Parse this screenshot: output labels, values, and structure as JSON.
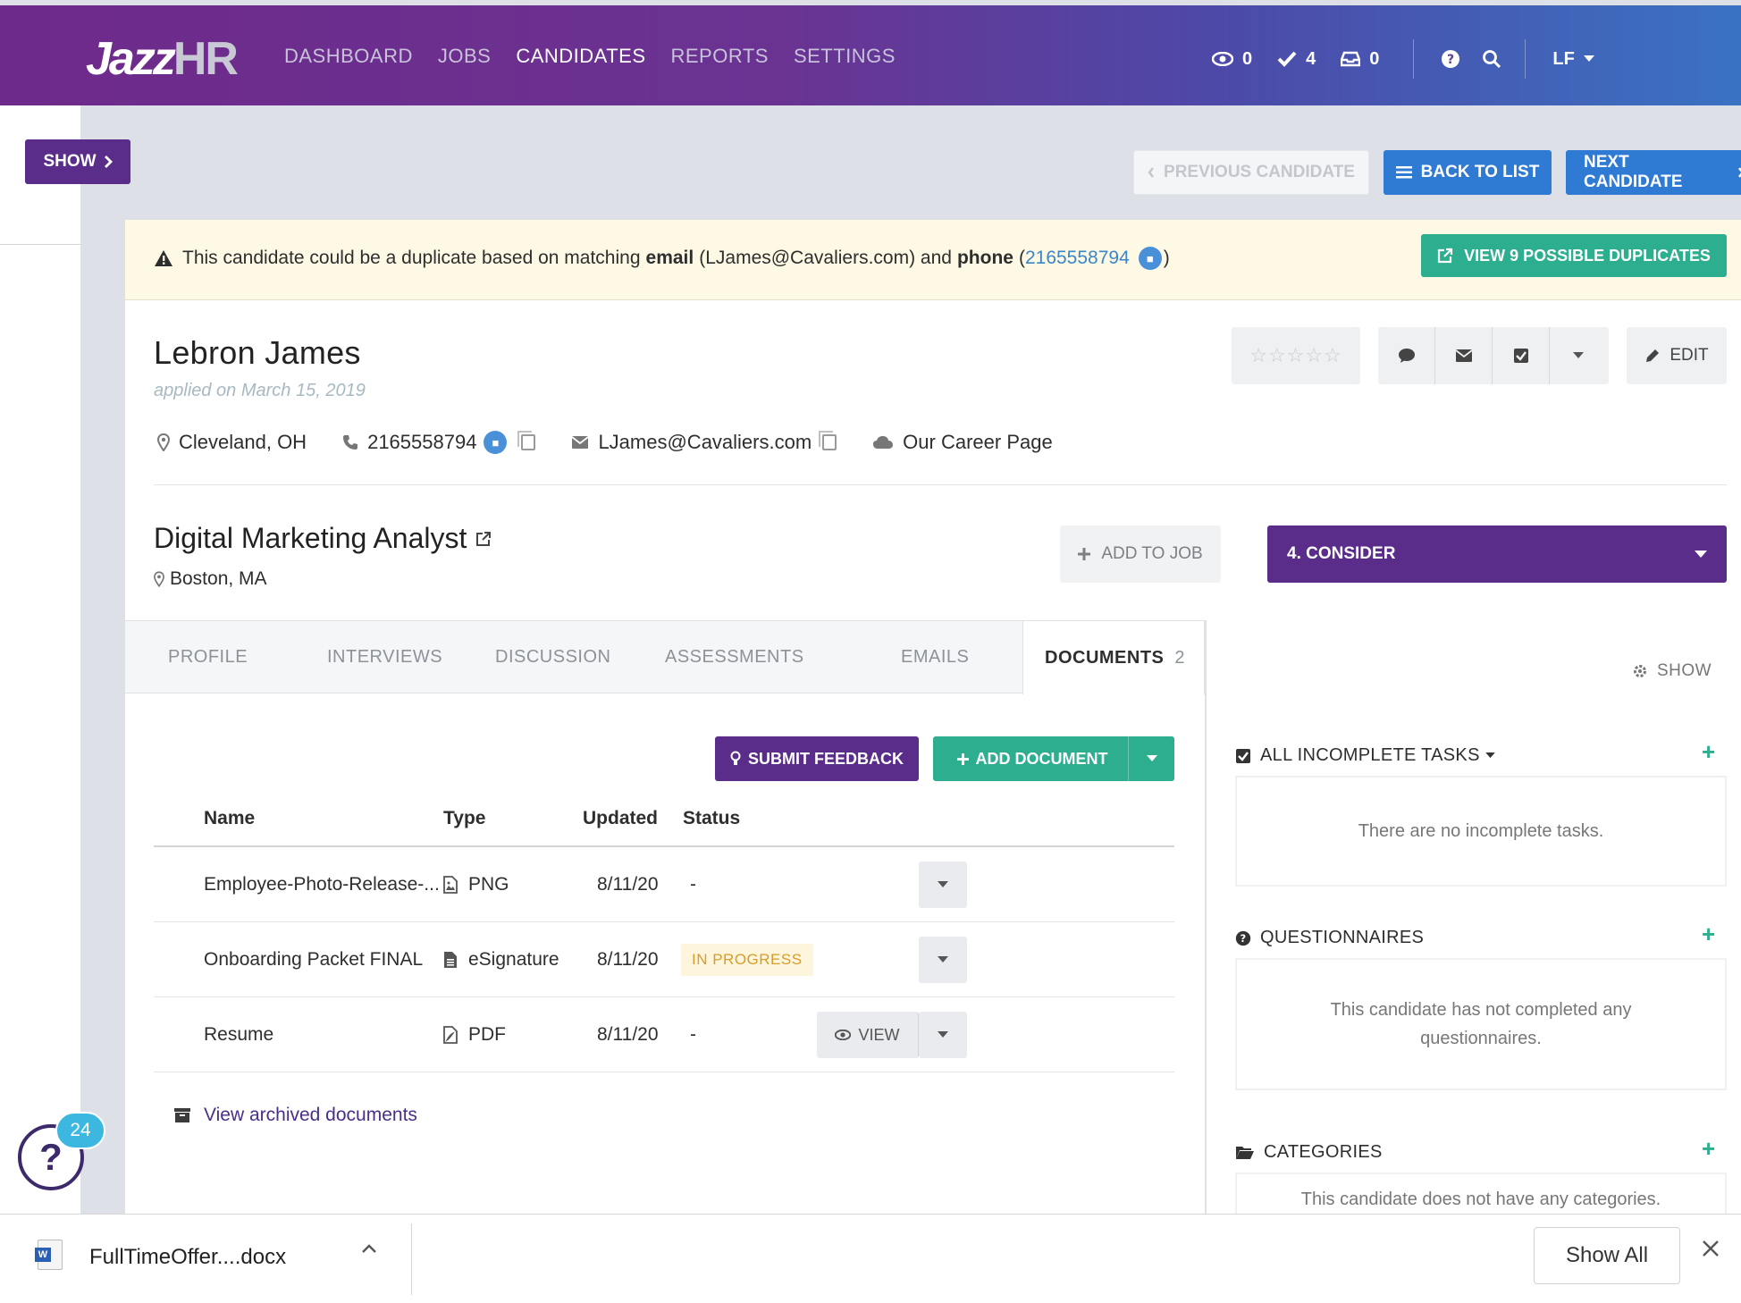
{
  "brand": {
    "logo_main": "Jazz",
    "logo_hr": "HR"
  },
  "nav": {
    "items": [
      "DASHBOARD",
      "JOBS",
      "CANDIDATES",
      "REPORTS",
      "SETTINGS"
    ],
    "active": "CANDIDATES",
    "watching_count": "0",
    "tasks_count": "4",
    "inbox_count": "0",
    "user_initials": "LF"
  },
  "sidebar": {
    "show_label": "SHOW"
  },
  "candidate_nav": {
    "previous_label": "PREVIOUS CANDIDATE",
    "back_label": "BACK TO LIST",
    "next_label": "NEXT CANDIDATE"
  },
  "duplicate_alert": {
    "text_start": "This candidate could be a duplicate based on matching",
    "email_word": "email",
    "email_value": "(LJames@Cavaliers.com) and",
    "phone_word": "phone",
    "phone_open": "(",
    "phone_value": "2165558794",
    "phone_close": ")",
    "button_label": "VIEW 9 POSSIBLE DUPLICATES"
  },
  "candidate": {
    "name": "Lebron James",
    "applied": "applied on March 15, 2019",
    "rating": 0,
    "location": "Cleveland, OH",
    "phone": "2165558794",
    "email": "LJames@Cavaliers.com",
    "source": "Our Career Page",
    "edit_label": "EDIT"
  },
  "job": {
    "title": "Digital Marketing Analyst",
    "location": "Boston, MA",
    "add_to_job_label": "ADD TO JOB",
    "stage_label": "4. CONSIDER"
  },
  "tabs": [
    {
      "label": "PROFILE"
    },
    {
      "label": "INTERVIEWS"
    },
    {
      "label": "DISCUSSION"
    },
    {
      "label": "ASSESSMENTS"
    },
    {
      "label": "EMAILS"
    },
    {
      "label": "DOCUMENTS",
      "count": "2"
    }
  ],
  "documents": {
    "submit_feedback_label": "SUBMIT FEEDBACK",
    "add_document_label": "ADD DOCUMENT",
    "columns": [
      "Name",
      "Type",
      "Updated",
      "Status"
    ],
    "rows": [
      {
        "name": "Employee-Photo-Release-...",
        "type": "PNG",
        "updated": "8/11/20",
        "status": "-"
      },
      {
        "name": "Onboarding Packet FINAL",
        "type": "eSignature",
        "updated": "8/11/20",
        "status": "IN PROGRESS"
      },
      {
        "name": "Resume",
        "type": "PDF",
        "updated": "8/11/20",
        "status": "-",
        "view_label": "VIEW"
      }
    ],
    "archived_link": "View archived documents"
  },
  "right_panel": {
    "show_label": "SHOW",
    "tasks_title": "ALL INCOMPLETE TASKS",
    "tasks_empty": "There are no incomplete tasks.",
    "questionnaires_title": "QUESTIONNAIRES",
    "questionnaires_empty": "This candidate has not completed any questionnaires.",
    "categories_title": "CATEGORIES",
    "categories_empty": "This candidate does not have any categories."
  },
  "help": {
    "badge_count": "24"
  },
  "download_bar": {
    "file_name": "FullTimeOffer....docx",
    "show_all_label": "Show All"
  },
  "colors": {
    "purple": "#5b2d8a",
    "blue": "#2f7bd4",
    "green": "#2cae8f",
    "warning_bg": "#fdf9e4",
    "in_progress": "#d79c2a"
  }
}
